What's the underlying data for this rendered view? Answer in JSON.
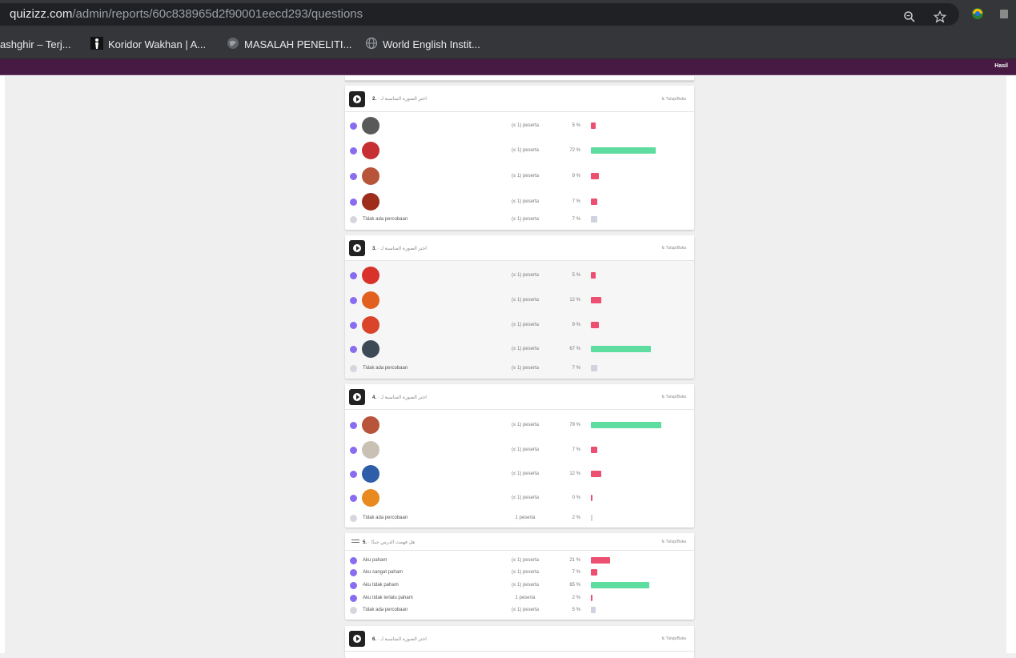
{
  "browser": {
    "url_host": "quizizz.com",
    "url_path": "/admin/reports/60c838965d2f90001eecd293/questions",
    "icons": [
      "zoom-icon",
      "star-icon",
      "extension-icon",
      "extension-icon-2"
    ]
  },
  "bookmarks": [
    {
      "label": "ashghir – Terj...",
      "icon": "none"
    },
    {
      "label": "Koridor Wakhan | A...",
      "icon": "person-icon"
    },
    {
      "label": "MASALAH PENELITI...",
      "icon": "globe-icon"
    },
    {
      "label": "World English Instit...",
      "icon": "globe-icon"
    }
  ],
  "quizbar": {
    "right_label": "Hasil"
  },
  "questions": [
    {
      "number": "2.",
      "subtitle": "· اختر الصورة المناسبة لـ",
      "close_label": "Tutup/Buka",
      "options": [
        {
          "thumb": "#5a5a5a",
          "peserta": "(≤ 1) peserta",
          "pct": "5 %",
          "bar": 0.05,
          "color": "red"
        },
        {
          "thumb": "#c62f34",
          "peserta": "(≤ 1) peserta",
          "pct": "72 %",
          "bar": 0.72,
          "color": "green"
        },
        {
          "thumb": "#b8543a",
          "peserta": "(≤ 1) peserta",
          "pct": "9 %",
          "bar": 0.09,
          "color": "red"
        },
        {
          "thumb": "#9e2d1c",
          "peserta": "(≤ 1) peserta",
          "pct": "7 %",
          "bar": 0.07,
          "color": "red"
        }
      ],
      "no_attempt": {
        "label": "Tidak ada percobaan",
        "peserta": "(≤ 1) peserta",
        "pct": "7 %",
        "bar": 0.07
      }
    },
    {
      "number": "3.",
      "subtitle": "· اختر الصورة المناسبة لـ",
      "close_label": "Tutup/Buka",
      "options": [
        {
          "thumb": "#d8322a",
          "peserta": "(≤ 1) peserta",
          "pct": "5 %",
          "bar": 0.05,
          "color": "red"
        },
        {
          "thumb": "#e2601f",
          "peserta": "(≤ 1) peserta",
          "pct": "12 %",
          "bar": 0.12,
          "color": "red"
        },
        {
          "thumb": "#d9442a",
          "peserta": "(≤ 1) peserta",
          "pct": "9 %",
          "bar": 0.09,
          "color": "red"
        },
        {
          "thumb": "#3d4a55",
          "peserta": "(≤ 1) peserta",
          "pct": "67 %",
          "bar": 0.67,
          "color": "green"
        }
      ],
      "no_attempt": {
        "label": "Tidak ada percobaan",
        "peserta": "(≤ 1) peserta",
        "pct": "7 %",
        "bar": 0.07
      }
    },
    {
      "number": "4.",
      "subtitle": "· اختر الصورة المناسبة لـ",
      "close_label": "Tutup/Buka",
      "options": [
        {
          "thumb": "#b8543a",
          "peserta": "(≤ 1) peserta",
          "pct": "79 %",
          "bar": 0.79,
          "color": "green"
        },
        {
          "thumb": "#c9c1b3",
          "peserta": "(≤ 1) peserta",
          "pct": "7 %",
          "bar": 0.07,
          "color": "red"
        },
        {
          "thumb": "#2e5ea8",
          "peserta": "(≤ 1) peserta",
          "pct": "12 %",
          "bar": 0.12,
          "color": "red"
        },
        {
          "thumb": "#e88a1f",
          "peserta": "(≤ 1) peserta",
          "pct": "0 %",
          "bar": 0.0,
          "color": "red"
        }
      ],
      "no_attempt": {
        "label": "Tidak ada percobaan",
        "peserta": "1 peserta",
        "pct": "2 %",
        "bar": 0.02
      }
    },
    {
      "number": "5.",
      "subtitle": "· هل فهمت الدرس جيدًا",
      "close_label": "Tutup/Buka",
      "options": [
        {
          "label": "Aku paham",
          "peserta": "(≤ 1) peserta",
          "pct": "21 %",
          "bar": 0.21,
          "color": "red"
        },
        {
          "label": "Aku sangat paham",
          "peserta": "(≤ 1) peserta",
          "pct": "7 %",
          "bar": 0.07,
          "color": "red"
        },
        {
          "label": "Aku tidak paham",
          "peserta": "(≤ 1) peserta",
          "pct": "65 %",
          "bar": 0.65,
          "color": "green"
        },
        {
          "label": "Aku tidak terlalu paham",
          "peserta": "1 peserta",
          "pct": "2 %",
          "bar": 0.02,
          "color": "red"
        }
      ],
      "no_attempt": {
        "label": "Tidak ada percobaan",
        "peserta": "(≤ 1) peserta",
        "pct": "5 %",
        "bar": 0.05
      }
    },
    {
      "number": "6.",
      "subtitle": "· اختر الصورة المناسبة لـ",
      "close_label": "Tutup/Buka"
    }
  ]
}
